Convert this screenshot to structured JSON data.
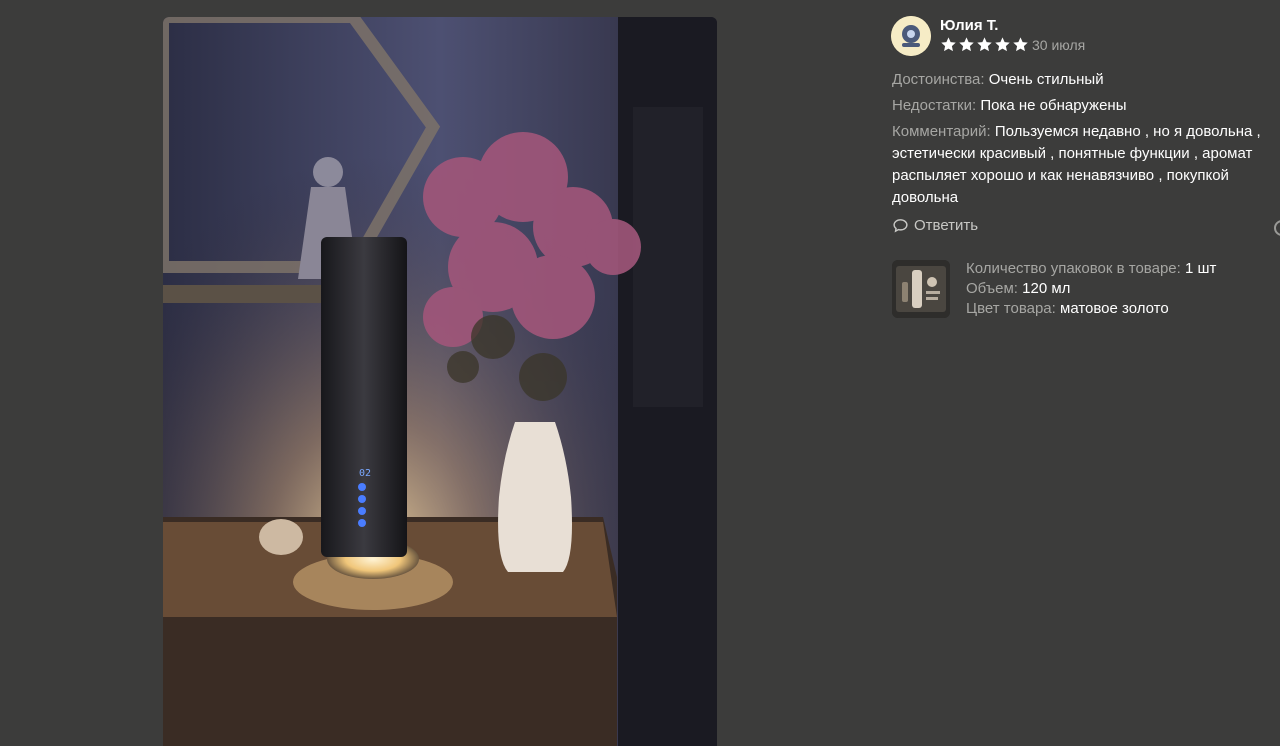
{
  "review": {
    "author": "Юлия Т.",
    "rating": 5,
    "date": "30 июля",
    "pros_label": "Достоинства:",
    "pros_value": "Очень стильный",
    "cons_label": "Недостатки:",
    "cons_value": "Пока не обнаружены",
    "comment_label": "Комментарий:",
    "comment_value": "Пользуемся недавно , но я довольна , эстетически красивый , понятные функции , аромат распыляет хорошо и как ненавязчиво , покупкой довольна",
    "reply_label": "Ответить"
  },
  "product": {
    "packs_label": "Количество упаковок в товаре:",
    "packs_value": "1 шт",
    "volume_label": "Объем:",
    "volume_value": "120 мл",
    "color_label": "Цвет товара:",
    "color_value": "матовое золото"
  },
  "colors": {
    "background": "#3c3c3b",
    "star": "#ffffff",
    "muted_text": "#a6a6a3"
  }
}
